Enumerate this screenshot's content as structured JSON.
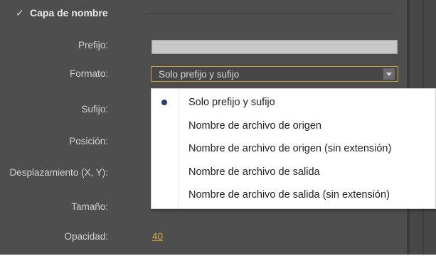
{
  "section": {
    "title": "Capa de nombre",
    "checked": true
  },
  "fields": {
    "prefix_label": "Prefijo:",
    "prefix_value": "",
    "format_label": "Formato:",
    "format_value": "Solo prefijo y sufijo",
    "suffix_label": "Sufijo:",
    "position_label": "Posición:",
    "offset_label": "Desplazamiento (X, Y):",
    "size_label": "Tamaño:",
    "opacity_label": "Opacidad:",
    "opacity_value": "40"
  },
  "format_menu": {
    "selected_index": 0,
    "items": [
      "Solo prefijo y sufijo",
      "Nombre de archivo de origen",
      "Nombre de archivo de origen (sin extensión)",
      "Nombre de archivo de salida",
      "Nombre de archivo de salida (sin extensión)"
    ]
  },
  "colors": {
    "panel_bg": "#4e4e4e",
    "accent": "#d8b040",
    "focus_border": "#c9a13b"
  }
}
